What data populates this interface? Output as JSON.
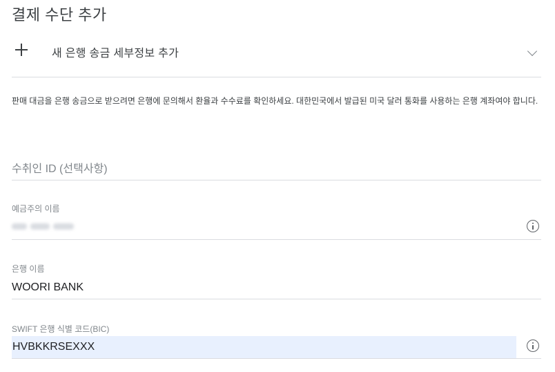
{
  "page": {
    "title": "결제 수단 추가"
  },
  "add_bank_transfer": {
    "label": "새 은행 송금 세부정보 추가",
    "icon": "plus-icon",
    "toggle_icon": "chevron-down-icon"
  },
  "notice": "판매 대금을 은행 송금으로 받으려면 은행에 문의해서 환율과 수수료를 확인하세요. 대한민국에서 발급된 미국 달러 통화를 사용하는 은행 계좌여야 합니다.",
  "form": {
    "recipient_id": {
      "placeholder": "수취인 ID (선택사항)",
      "value": ""
    },
    "account_holder": {
      "label": "예금주의 이름",
      "value_redacted": true,
      "info_icon": "info-icon"
    },
    "bank_name": {
      "label": "은행 이름",
      "value": "WOORI BANK"
    },
    "swift_code": {
      "label": "SWIFT 은행 식별 코드(BIC)",
      "value": "HVBKKRSEXXX",
      "info_icon": "info-icon"
    }
  },
  "colors": {
    "divider": "#dadce0",
    "label": "#80868b",
    "autofill_background": "#e8f0fe",
    "text": "#202124"
  }
}
